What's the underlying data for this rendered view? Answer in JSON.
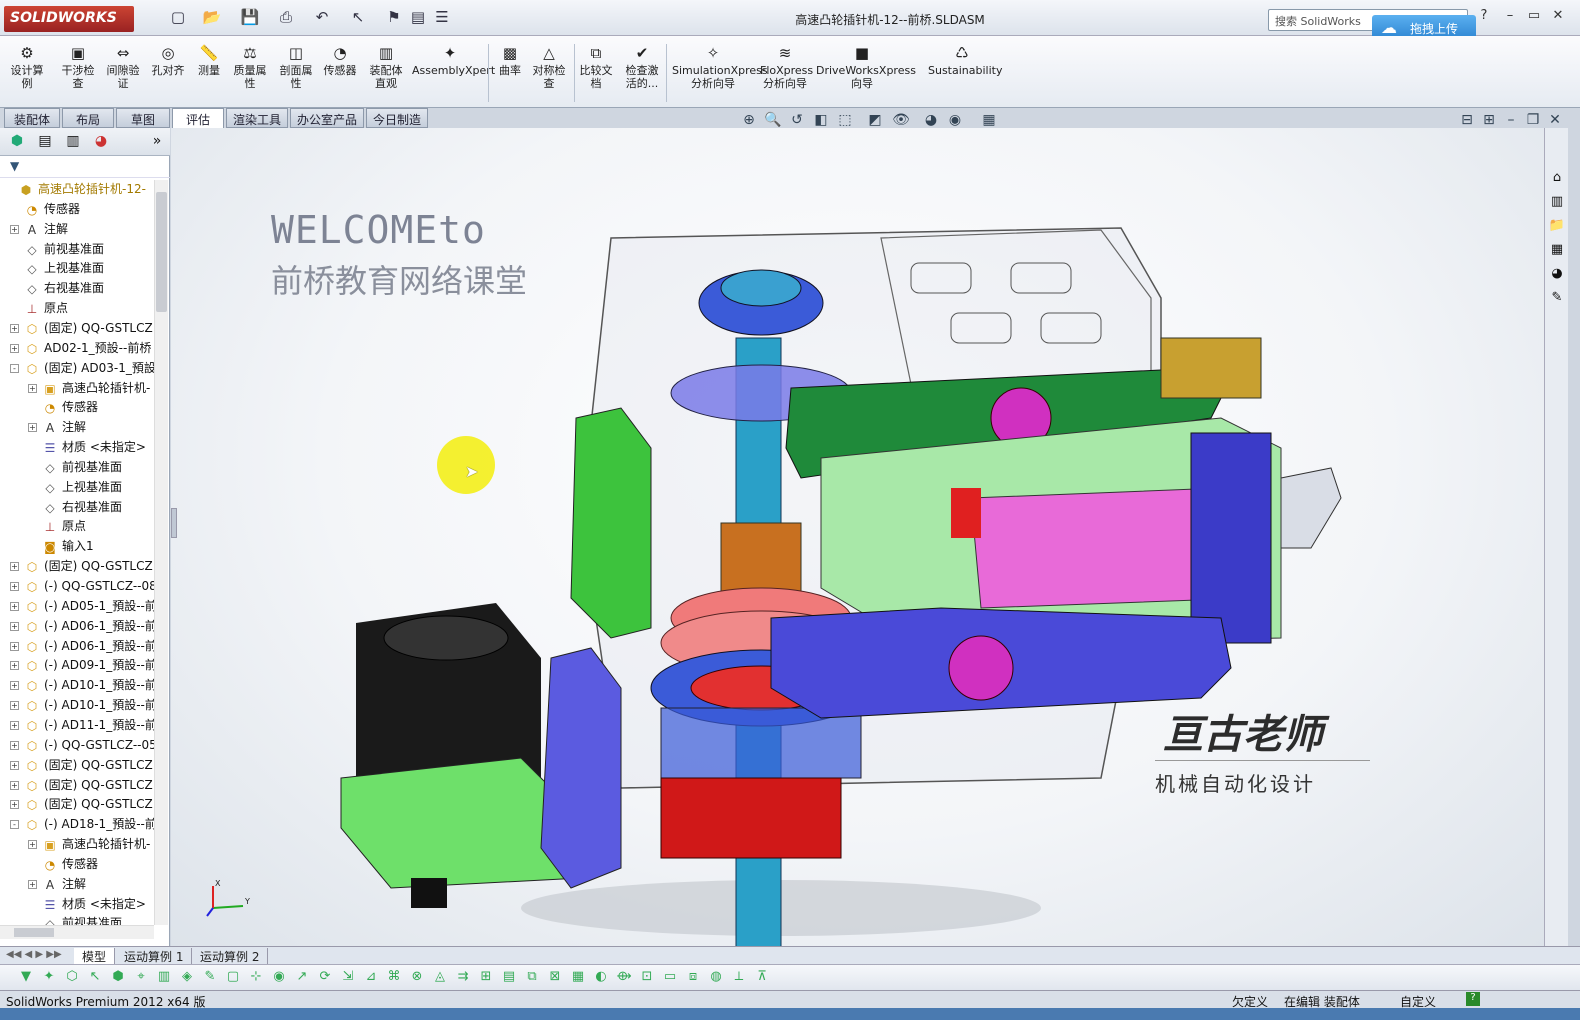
{
  "app": {
    "logo_text": "SOLIDWORKS",
    "window_title": "高速凸轮插针机-12--前桥.SLDASM",
    "search_placeholder": "搜索 SolidWorks",
    "upload_label": "拖拽上传"
  },
  "command_manager": [
    {
      "label": "设计算例",
      "icon": "design-study-icon"
    },
    {
      "label": "干涉检查",
      "icon": "interference-icon"
    },
    {
      "label": "间隙验证",
      "icon": "clearance-icon"
    },
    {
      "label": "孔对齐",
      "icon": "hole-align-icon"
    },
    {
      "label": "测量",
      "icon": "measure-icon"
    },
    {
      "label": "质量属性",
      "icon": "mass-props-icon"
    },
    {
      "label": "剖面属性",
      "icon": "section-props-icon"
    },
    {
      "label": "传感器",
      "icon": "sensor-icon"
    },
    {
      "label": "装配体直观",
      "icon": "assembly-visual-icon"
    },
    {
      "label": "AssemblyXpert",
      "icon": "assemblyxpert-icon"
    },
    {
      "label": "曲率",
      "icon": "curvature-icon"
    },
    {
      "label": "对称检查",
      "icon": "symmetry-icon"
    },
    {
      "label": "比较文档",
      "icon": "compare-icon"
    },
    {
      "label": "检查激活的...",
      "icon": "check-icon"
    },
    {
      "label": "SimulationXpress分析向导",
      "icon": "simulation-icon"
    },
    {
      "label": "FloXpress分析向导",
      "icon": "floxpress-icon"
    },
    {
      "label": "DriveWorksXpress向导",
      "icon": "driveworks-icon"
    },
    {
      "label": "Sustainability",
      "icon": "sustainability-icon"
    }
  ],
  "tabs": [
    "装配体",
    "布局",
    "草图",
    "评估",
    "渲染工具",
    "办公室产品",
    "今日制造"
  ],
  "active_tab": "评估",
  "tree": [
    {
      "label": "高速凸轮插针机-12-",
      "level": 0,
      "icon": "assembly-icon",
      "toggle": ""
    },
    {
      "label": "传感器",
      "level": 1,
      "icon": "sensor-folder-icon",
      "toggle": ""
    },
    {
      "label": "注解",
      "level": 1,
      "icon": "annotation-icon",
      "toggle": "+"
    },
    {
      "label": "前视基准面",
      "level": 1,
      "icon": "plane-icon",
      "toggle": ""
    },
    {
      "label": "上视基准面",
      "level": 1,
      "icon": "plane-icon",
      "toggle": ""
    },
    {
      "label": "右视基准面",
      "level": 1,
      "icon": "plane-icon",
      "toggle": ""
    },
    {
      "label": "原点",
      "level": 1,
      "icon": "origin-icon",
      "toggle": ""
    },
    {
      "label": "(固定) QQ-GSTLCZ",
      "level": 1,
      "icon": "part-icon",
      "toggle": "+"
    },
    {
      "label": "AD02-1_预設--前桥",
      "level": 1,
      "icon": "part-icon",
      "toggle": "+"
    },
    {
      "label": "(固定) AD03-1_預設",
      "level": 1,
      "icon": "part-icon",
      "toggle": "-"
    },
    {
      "label": "高速凸轮插针机-",
      "level": 2,
      "icon": "sub-assembly-icon",
      "toggle": "+"
    },
    {
      "label": "传感器",
      "level": 2,
      "icon": "sensor-folder-icon",
      "toggle": ""
    },
    {
      "label": "注解",
      "level": 2,
      "icon": "annotation-icon",
      "toggle": "+"
    },
    {
      "label": "材质 <未指定>",
      "level": 2,
      "icon": "material-icon",
      "toggle": ""
    },
    {
      "label": "前视基准面",
      "level": 2,
      "icon": "plane-icon",
      "toggle": ""
    },
    {
      "label": "上视基准面",
      "level": 2,
      "icon": "plane-icon",
      "toggle": ""
    },
    {
      "label": "右视基准面",
      "level": 2,
      "icon": "plane-icon",
      "toggle": ""
    },
    {
      "label": "原点",
      "level": 2,
      "icon": "origin-icon",
      "toggle": ""
    },
    {
      "label": "输入1",
      "level": 2,
      "icon": "import-icon",
      "toggle": ""
    },
    {
      "label": "(固定) QQ-GSTLCZ",
      "level": 1,
      "icon": "part-icon",
      "toggle": "+"
    },
    {
      "label": "(-) QQ-GSTLCZ--08",
      "level": 1,
      "icon": "part-icon",
      "toggle": "+"
    },
    {
      "label": "(-) AD05-1_預設--前",
      "level": 1,
      "icon": "part-icon",
      "toggle": "+"
    },
    {
      "label": "(-) AD06-1_預設--前",
      "level": 1,
      "icon": "part-icon",
      "toggle": "+"
    },
    {
      "label": "(-) AD06-1_預設--前",
      "level": 1,
      "icon": "part-icon",
      "toggle": "+"
    },
    {
      "label": "(-) AD09-1_預設--前",
      "level": 1,
      "icon": "part-icon",
      "toggle": "+"
    },
    {
      "label": "(-) AD10-1_預設--前",
      "level": 1,
      "icon": "part-icon",
      "toggle": "+"
    },
    {
      "label": "(-) AD10-1_預設--前",
      "level": 1,
      "icon": "part-icon",
      "toggle": "+"
    },
    {
      "label": "(-) AD11-1_預設--前",
      "level": 1,
      "icon": "part-icon",
      "toggle": "+"
    },
    {
      "label": "(-) QQ-GSTLCZ--05",
      "level": 1,
      "icon": "part-icon",
      "toggle": "+"
    },
    {
      "label": "(固定) QQ-GSTLCZ",
      "level": 1,
      "icon": "part-icon",
      "toggle": "+"
    },
    {
      "label": "(固定) QQ-GSTLCZ",
      "level": 1,
      "icon": "part-icon",
      "toggle": "+"
    },
    {
      "label": "(固定) QQ-GSTLCZ",
      "level": 1,
      "icon": "part-icon",
      "toggle": "+"
    },
    {
      "label": "(-) AD18-1_預設--前",
      "level": 1,
      "icon": "part-icon",
      "toggle": "-"
    },
    {
      "label": "高速凸轮插针机-",
      "level": 2,
      "icon": "sub-assembly-icon",
      "toggle": "+"
    },
    {
      "label": "传感器",
      "level": 2,
      "icon": "sensor-folder-icon",
      "toggle": ""
    },
    {
      "label": "注解",
      "level": 2,
      "icon": "annotation-icon",
      "toggle": "+"
    },
    {
      "label": "材质 <未指定>",
      "level": 2,
      "icon": "material-icon",
      "toggle": ""
    },
    {
      "label": "前视基准面",
      "level": 2,
      "icon": "plane-icon",
      "toggle": ""
    }
  ],
  "viewport": {
    "welcome_line1": "WELCOMEto",
    "welcome_line2": "前桥教育网络课堂",
    "teacher_name": "亘古老师",
    "teacher_subtitle": "机械自动化设计",
    "triad_x": "X",
    "triad_y": "Y"
  },
  "bottom_tabs": [
    "模型",
    "运动算例 1",
    "运动算例 2"
  ],
  "status": {
    "version": "SolidWorks Premium 2012 x64 版",
    "state": "欠定义",
    "mode": "在编辑 装配体",
    "units": "自定义"
  }
}
